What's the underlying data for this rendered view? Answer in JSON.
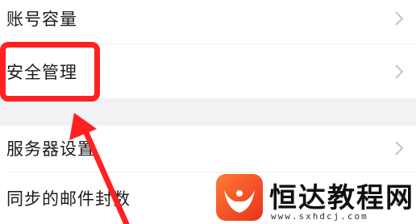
{
  "settings": {
    "items": [
      {
        "label": "账号容量",
        "icon": "chevron-right-icon"
      },
      {
        "label": "安全管理",
        "icon": "chevron-right-icon"
      },
      {
        "label": "服务器设置",
        "icon": "chevron-right-icon"
      },
      {
        "label": "同步的邮件封数",
        "icon": "chevron-right-icon"
      }
    ]
  },
  "annotation": {
    "highlight_color": "#ff2121",
    "arrow_color": "#ff2121",
    "target": "安全管理"
  },
  "watermark": {
    "brand": "恒达教程网",
    "url": "www.sxhdcj.com",
    "logo_colors": [
      "#ff6a2b",
      "#e8331c"
    ]
  },
  "colors": {
    "background": "#ffffff",
    "section_gap": "#f2f2f4",
    "chevron": "#c4c4c4"
  }
}
